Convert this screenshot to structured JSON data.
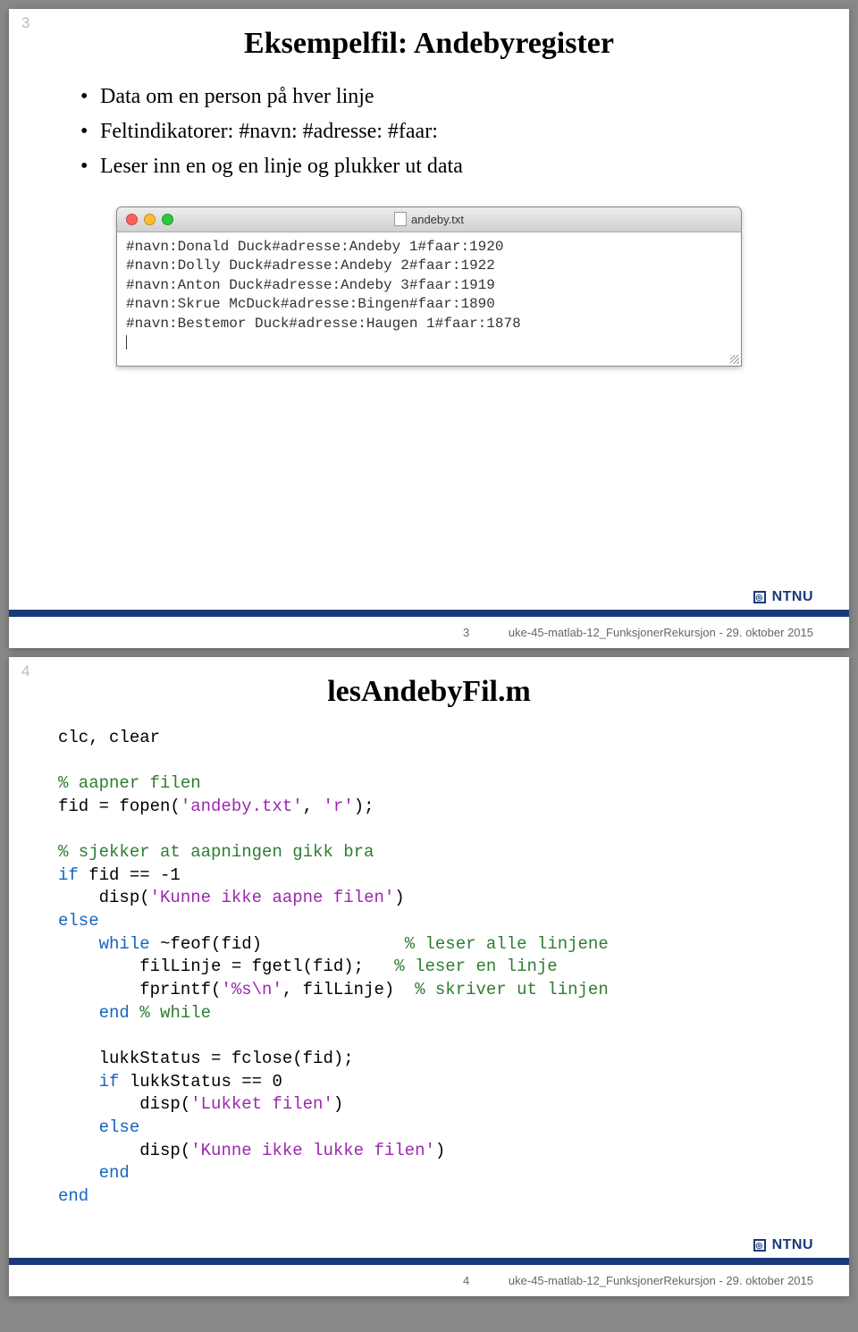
{
  "slide1": {
    "num": "3",
    "title": "Eksempelfil: Andebyregister",
    "bullets": [
      "Data om en person på hver linje",
      "Feltindikatorer: #navn: #adresse: #faar:",
      "Leser inn en og en linje og plukker ut data"
    ],
    "window": {
      "filename": "andeby.txt",
      "lines": [
        "#navn:Donald Duck#adresse:Andeby 1#faar:1920",
        "#navn:Dolly Duck#adresse:Andeby 2#faar:1922",
        "#navn:Anton Duck#adresse:Andeby 3#faar:1919",
        "#navn:Skrue McDuck#adresse:Bingen#faar:1890",
        "#navn:Bestemor Duck#adresse:Haugen 1#faar:1878"
      ]
    },
    "footer_page": "3",
    "footer_text": "uke-45-matlab-12_FunksjonerRekursjon - 29. oktober 2015",
    "logo": "NTNU"
  },
  "slide2": {
    "num": "4",
    "title": "lesAndebyFil.m",
    "code": {
      "l1": "clc, clear",
      "c1": "% aapner filen",
      "l2a": "fid = fopen(",
      "l2s1": "'andeby.txt'",
      "l2b": ", ",
      "l2s2": "'r'",
      "l2c": ");",
      "c2": "% sjekker at aapningen gikk bra",
      "l3": "if",
      "l3b": " fid == -1",
      "l4a": "    disp(",
      "l4s": "'Kunne ikke aapne filen'",
      "l4b": ")",
      "l5": "else",
      "l6a": "    ",
      "l6kw": "while",
      "l6b": " ~feof(fid)",
      "l6c": "              ",
      "c6": "% leser alle linjene",
      "l7": "        filLinje = fgetl(fid);   ",
      "c7": "% leser en linje",
      "l8a": "        fprintf(",
      "l8s": "'%s\\n'",
      "l8b": ", filLinje)  ",
      "c8": "% skriver ut linjen",
      "l9a": "    ",
      "l9kw": "end",
      "l9b": " ",
      "c9": "% while",
      "l10": "    lukkStatus = fclose(fid);",
      "l11a": "    ",
      "l11kw": "if",
      "l11b": " lukkStatus == 0",
      "l12a": "        disp(",
      "l12s": "'Lukket filen'",
      "l12b": ")",
      "l13a": "    ",
      "l13": "else",
      "l14a": "        disp(",
      "l14s": "'Kunne ikke lukke filen'",
      "l14b": ")",
      "l15a": "    ",
      "l15": "end",
      "l16": "end"
    },
    "footer_page": "4",
    "footer_text": "uke-45-matlab-12_FunksjonerRekursjon - 29. oktober 2015",
    "logo": "NTNU"
  }
}
